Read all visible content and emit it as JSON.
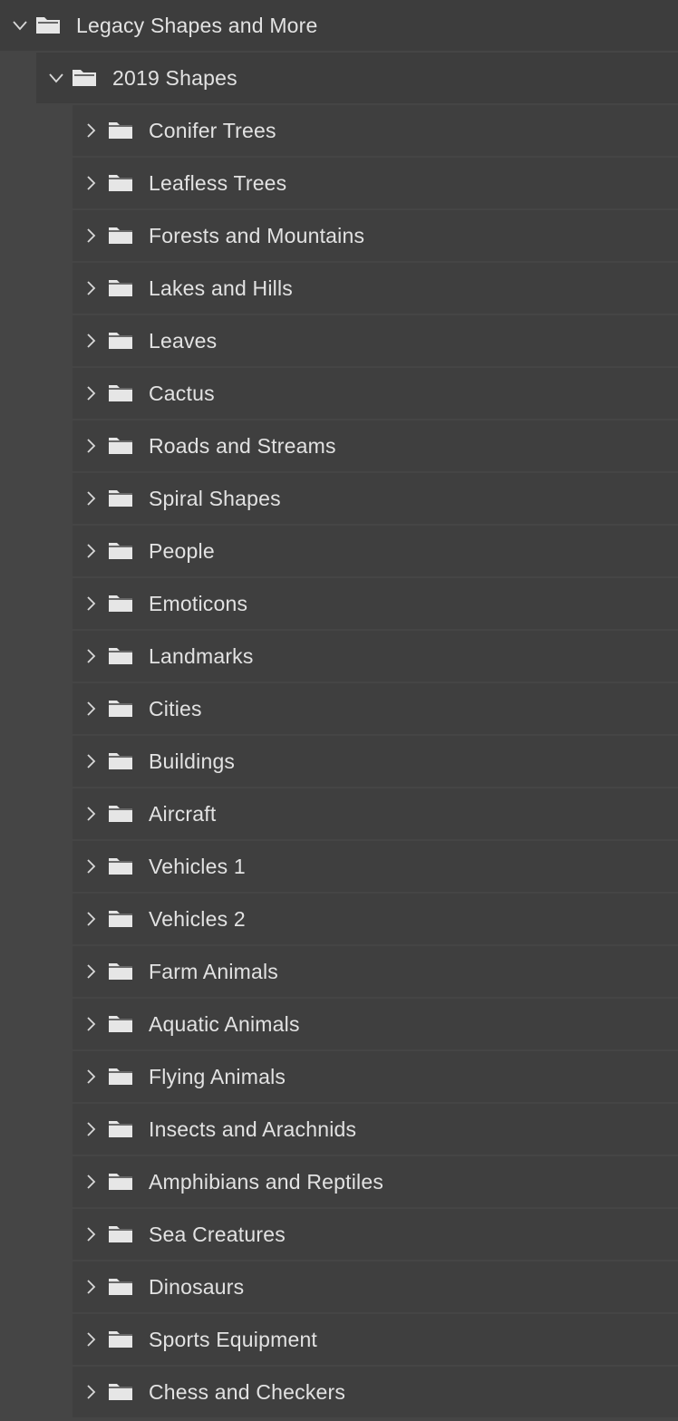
{
  "tree": {
    "root": {
      "label": "Legacy Shapes and More",
      "expanded": true,
      "icon": "folder-open-icon"
    },
    "group": {
      "label": "2019 Shapes",
      "expanded": true,
      "icon": "folder-open-icon"
    },
    "items": [
      {
        "label": "Conifer Trees"
      },
      {
        "label": "Leafless Trees"
      },
      {
        "label": "Forests and Mountains"
      },
      {
        "label": "Lakes and Hills"
      },
      {
        "label": "Leaves"
      },
      {
        "label": "Cactus"
      },
      {
        "label": "Roads and Streams"
      },
      {
        "label": "Spiral Shapes"
      },
      {
        "label": "People"
      },
      {
        "label": "Emoticons"
      },
      {
        "label": "Landmarks"
      },
      {
        "label": "Cities"
      },
      {
        "label": "Buildings"
      },
      {
        "label": "Aircraft"
      },
      {
        "label": "Vehicles 1"
      },
      {
        "label": "Vehicles 2"
      },
      {
        "label": "Farm Animals"
      },
      {
        "label": "Aquatic Animals"
      },
      {
        "label": "Flying Animals"
      },
      {
        "label": "Insects and Arachnids"
      },
      {
        "label": "Amphibians and Reptiles"
      },
      {
        "label": "Sea Creatures"
      },
      {
        "label": "Dinosaurs"
      },
      {
        "label": "Sports Equipment"
      },
      {
        "label": "Chess and Checkers"
      }
    ]
  },
  "colors": {
    "panel_bg": "#454545",
    "row_bg": "#3f3f3f",
    "text": "#e2e2e2",
    "icon": "#e6e6e6"
  }
}
